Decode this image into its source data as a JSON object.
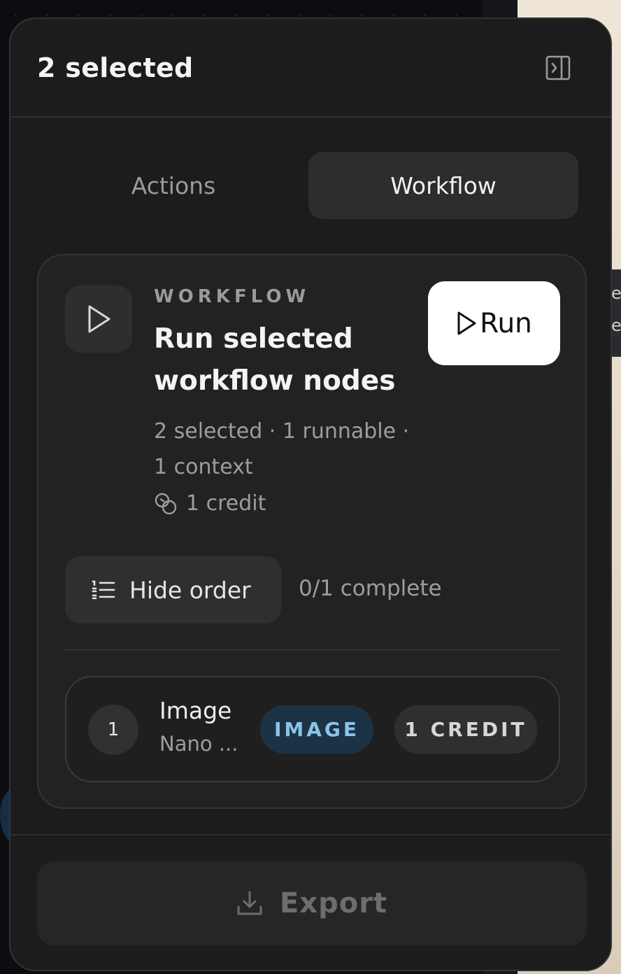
{
  "header": {
    "title": "2 selected"
  },
  "tabs": [
    {
      "label": "Actions",
      "active": false
    },
    {
      "label": "Workflow",
      "active": true
    }
  ],
  "workflow": {
    "eyebrow": "WORKFLOW",
    "title": "Run selected workflow nodes",
    "run_label": "Run",
    "summary": "2 selected · 1 runnable · 1 context",
    "credits": "1 credit",
    "order_toggle_label": "Hide order",
    "progress": "0/1 complete",
    "steps": [
      {
        "number": "1",
        "name": "Image",
        "model": "Nano ...",
        "type_badge": "IMAGE",
        "credit_badge": "1 CREDIT"
      }
    ]
  },
  "footer": {
    "export_label": "Export"
  },
  "background": {
    "edge_text": "e\ne"
  },
  "colors": {
    "panel_bg": "#1c1c1d",
    "card_bg": "#222223",
    "active_tab_bg": "#2d2d2f",
    "run_button_bg": "#ffffff",
    "image_badge_bg": "#1c3345",
    "image_badge_text": "#8cc4e8"
  },
  "icons": {
    "collapse": "sidebar-collapse-icon",
    "play": "play-icon",
    "run": "play-outline-icon",
    "credits": "coins-icon",
    "order": "numbered-list-icon",
    "export": "download-icon"
  }
}
